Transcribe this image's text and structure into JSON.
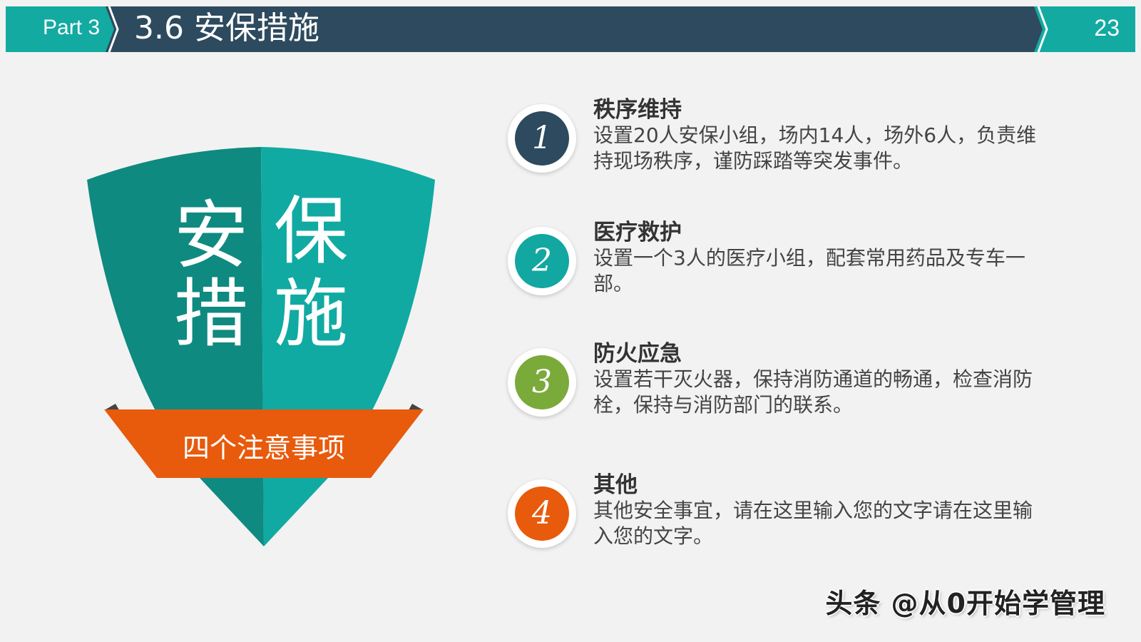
{
  "header": {
    "part": "Part 3",
    "title": "3.6 安保措施",
    "page": "23"
  },
  "shield": {
    "chars": [
      "安",
      "保",
      "措",
      "施"
    ],
    "ribbon_label": "四个注意事项"
  },
  "items": [
    {
      "number": "1",
      "title": "秩序维持",
      "desc": "设置20人安保小组，场内14人，场外6人，负责维持现场秩序，谨防踩踏等突发事件。",
      "color": "#2d4a5e"
    },
    {
      "number": "2",
      "title": "医疗救护",
      "desc": "设置一个3人的医疗小组，配套常用药品及专车一部。",
      "color": "#12a7a0"
    },
    {
      "number": "3",
      "title": "防火应急",
      "desc": "设置若干灭火器，保持消防通道的畅通，检查消防栓，保持与消防部门的联系。",
      "color": "#7aaa3a"
    },
    {
      "number": "4",
      "title": "其他",
      "desc": "其他安全事宜，请在这里输入您的文字请在这里输入您的文字。",
      "color": "#e85a0c"
    }
  ],
  "watermark": "头条 @从0开始学管理",
  "colors": {
    "header_navy": "#2d4a5e",
    "header_teal": "#13aaa2",
    "shield_dark": "#0f8a80",
    "shield_light": "#10aaa2",
    "ribbon": "#e85a0c"
  }
}
